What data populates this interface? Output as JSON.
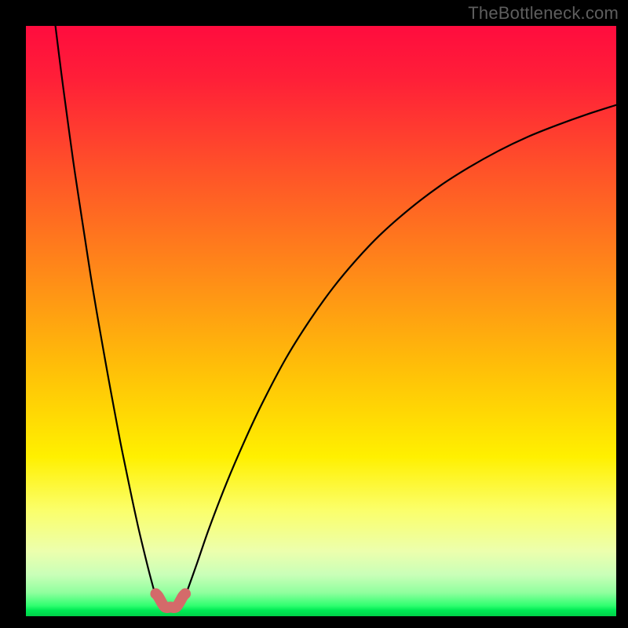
{
  "watermark": "TheBottleneck.com",
  "chart_data": {
    "type": "line",
    "title": "",
    "xlabel": "",
    "ylabel": "",
    "xlim": [
      0,
      100
    ],
    "ylim": [
      0,
      100
    ],
    "grid": false,
    "legend": false,
    "series": [
      {
        "name": "left-branch",
        "x": [
          5.0,
          6.0,
          7.0,
          8.0,
          9.0,
          10.0,
          11.0,
          12.0,
          13.0,
          14.0,
          15.0,
          16.0,
          17.0,
          18.0,
          19.0,
          20.0,
          21.0,
          22.0
        ],
        "y": [
          100.0,
          92.0,
          84.5,
          77.2,
          70.5,
          64.0,
          57.5,
          51.5,
          45.8,
          40.2,
          34.8,
          29.5,
          24.6,
          19.8,
          15.2,
          11.0,
          7.0,
          3.4
        ]
      },
      {
        "name": "trough",
        "x": [
          22.0,
          22.5,
          23.0,
          23.5,
          24.0,
          24.5,
          25.0,
          25.5,
          26.0,
          26.5,
          27.0
        ],
        "y": [
          3.4,
          2.3,
          1.9,
          1.75,
          1.7,
          1.7,
          1.7,
          1.75,
          1.9,
          2.3,
          3.4
        ]
      },
      {
        "name": "right-branch",
        "x": [
          27.0,
          29.0,
          31.0,
          34.0,
          37.0,
          40.0,
          44.0,
          48.0,
          52.0,
          56.0,
          60.0,
          65.0,
          70.0,
          75.0,
          80.0,
          85.0,
          90.0,
          95.0,
          100.0
        ],
        "y": [
          3.4,
          9.0,
          14.8,
          22.6,
          29.6,
          36.0,
          43.6,
          50.0,
          55.6,
          60.4,
          64.6,
          69.0,
          72.8,
          76.0,
          78.8,
          81.2,
          83.2,
          85.0,
          86.6
        ]
      }
    ],
    "bottleneck_marker": {
      "style": "rounded-U",
      "color": "#d46a6a",
      "x_range": [
        22.0,
        27.0
      ],
      "y_peak": 3.8
    },
    "background_gradient": {
      "orientation": "vertical",
      "stops": [
        {
          "pos": 0.0,
          "color": "#ff0c3e"
        },
        {
          "pos": 0.25,
          "color": "#ff5428"
        },
        {
          "pos": 0.5,
          "color": "#ffa010"
        },
        {
          "pos": 0.73,
          "color": "#fff000"
        },
        {
          "pos": 0.9,
          "color": "#ecffad"
        },
        {
          "pos": 0.985,
          "color": "#30ff70"
        },
        {
          "pos": 1.0,
          "color": "#00d149"
        }
      ]
    }
  }
}
